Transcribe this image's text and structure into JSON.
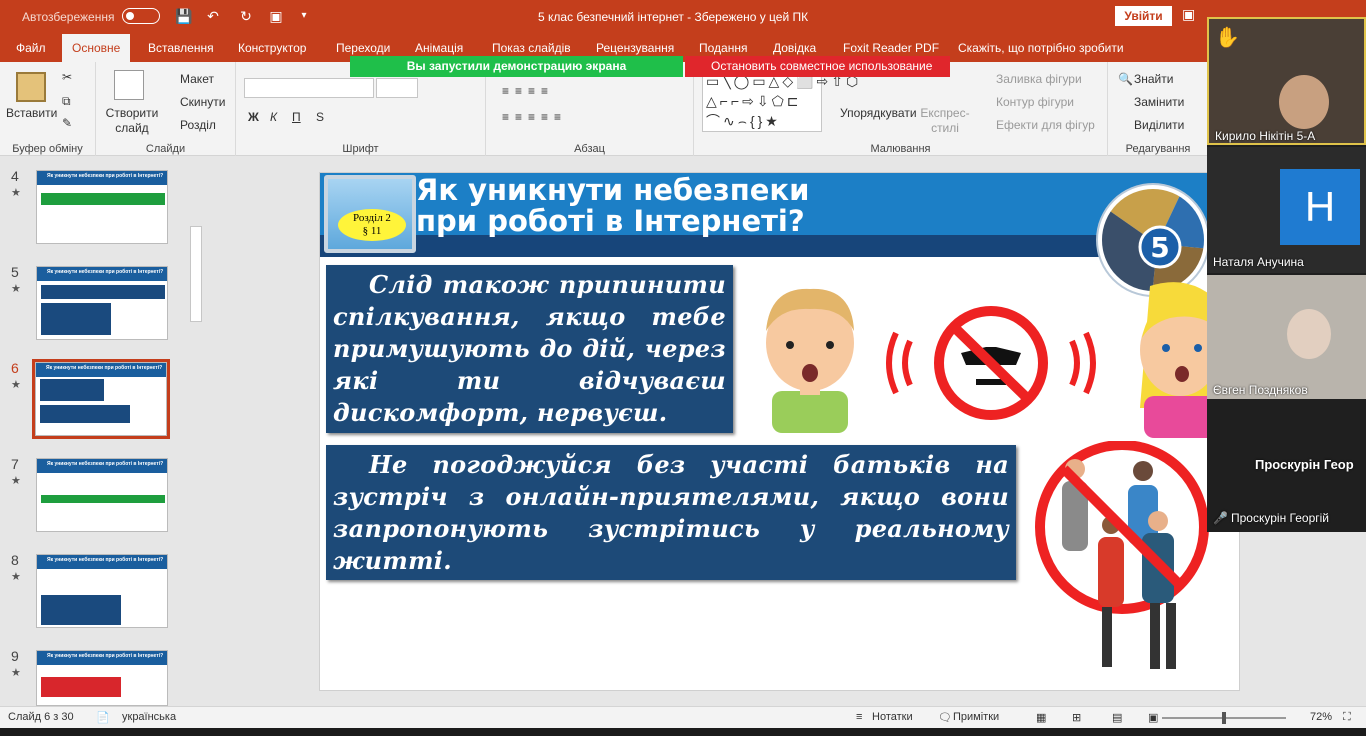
{
  "titlebar": {
    "autosave_label": "Автозбереження",
    "doc_title": "5 клас безпечний інтернет  -  Збережено у цей ПК",
    "signin": "Увійти"
  },
  "tabs": [
    "Файл",
    "Основне",
    "Вставлення",
    "Конструктор",
    "Переходи",
    "Анімація",
    "Показ слайдів",
    "Рецензування",
    "Подання",
    "Довідка",
    "Foxit Reader PDF",
    "Скажіть, що потрібно зробити"
  ],
  "ribbon": {
    "paste": "Вставити",
    "clipboard_group": "Буфер обміну",
    "new_slide": "Створити слайд",
    "layout": "Макет",
    "reset": "Скинути",
    "section": "Розділ",
    "slides_group": "Слайди",
    "font_group": "Шрифт",
    "bold": "Ж",
    "italic": "К",
    "underline": "П",
    "strike": "S",
    "paragraph_group": "Абзац",
    "arrange": "Упорядкувати",
    "quick_styles": "Експрес-стилі",
    "fill": "Заливка фігури",
    "outline": "Контур фігури",
    "effects": "Ефекти для фігур",
    "drawing_group": "Малювання",
    "find": "Знайти",
    "replace": "Замінити",
    "select": "Виділити",
    "editing_group": "Редагування"
  },
  "share": {
    "running": "Вы запустили демонстрацию экрана",
    "stop": "Остановить совместное использование"
  },
  "thumbnails": [
    {
      "num": "4",
      "title": "Як уникнути небезпеки при роботі в Інтернеті?"
    },
    {
      "num": "5",
      "title": "Як уникнути небезпеки при роботі в Інтернеті?"
    },
    {
      "num": "6",
      "title": "Як уникнути небезпеки при роботі в Інтернеті?"
    },
    {
      "num": "7",
      "title": "Як уникнути небезпеки при роботі в Інтернеті?"
    },
    {
      "num": "8",
      "title": "Як уникнути небезпеки при роботі в Інтернеті?"
    },
    {
      "num": "9",
      "title": "Як уникнути небезпеки при роботі в Інтернеті?"
    }
  ],
  "slide": {
    "title_line1": "Як уникнути небезпеки",
    "title_line2": "при роботі в Інтернеті?",
    "section_line1": "Розділ 2",
    "section_line2": "§ 11",
    "badge": "5",
    "text1": "Слід також припинити спілкування, якщо тебе примушують до дій, через які ти відчуваєш дискомфорт, нервуєш.",
    "text2": "Не погоджуйся без участі батьків на зустріч з онлайн-приятелями, якщо вони запропонують зустрітись у реальному житті."
  },
  "participants": [
    {
      "name": "Кирило Нікітін 5-А"
    },
    {
      "name": "Наталя Анучина",
      "initial": "Н"
    },
    {
      "name": "Євген Поздняков"
    },
    {
      "name": "Проскурін Геор"
    },
    {
      "name": "Проскурін Георгій"
    }
  ],
  "statusbar": {
    "slide_info": "Слайд 6 з 30",
    "language": "українська",
    "notes": "Нотатки",
    "comments": "Примітки",
    "zoom": "72%"
  },
  "colors": {
    "accent": "#c43e1c",
    "slide_blue": "#1c7fc6",
    "textbox": "#1d4a78"
  }
}
